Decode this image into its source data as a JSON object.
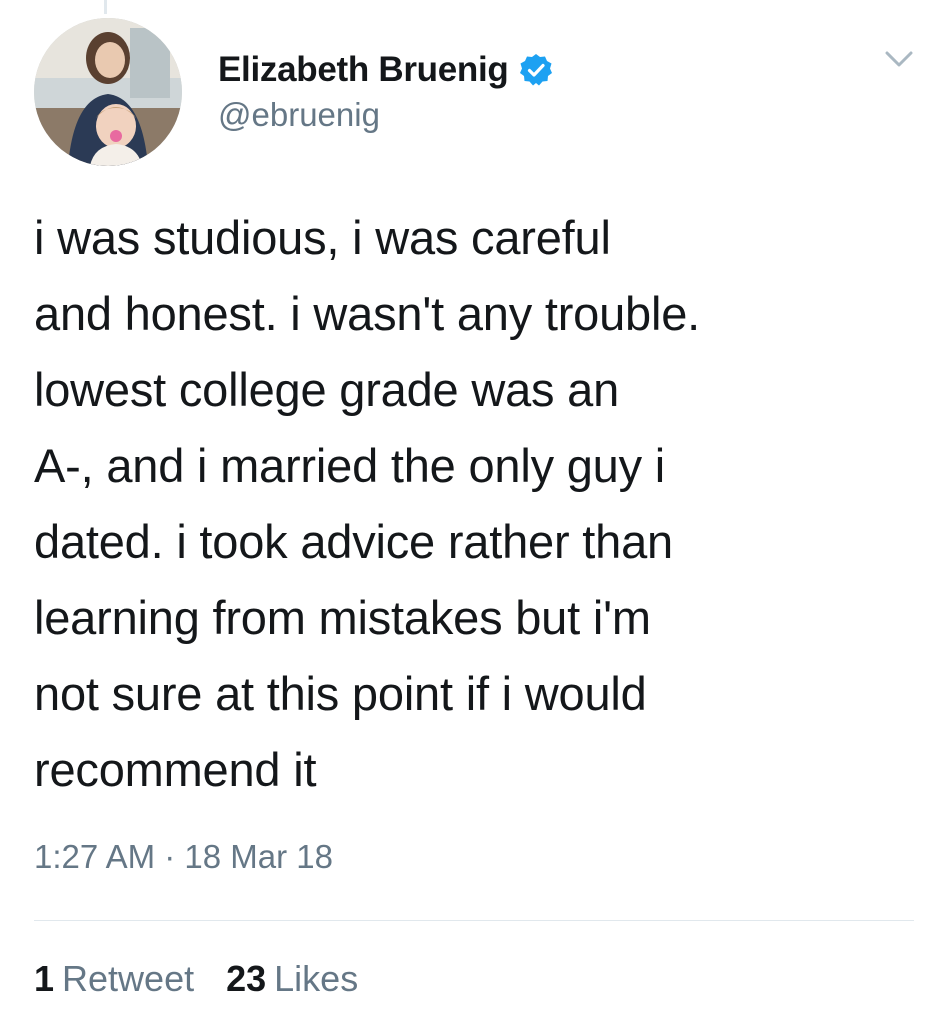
{
  "author": {
    "display_name": "Elizabeth Bruenig",
    "handle": "@ebruenig",
    "verified": true,
    "avatar_icon": "profile-photo"
  },
  "tweet": {
    "text": "i was studious, i was careful\nand honest. i wasn't any trouble.\nlowest college grade was an\nA-, and i married the only guy i\ndated. i took advice rather than\nlearning from mistakes but i'm\nnot sure at this point if i would\nrecommend it",
    "timestamp": "1:27 AM · 18 Mar 18"
  },
  "stats": {
    "retweets_count": "1",
    "retweets_label": "Retweet",
    "likes_count": "23",
    "likes_label": "Likes"
  },
  "colors": {
    "text": "#14171a",
    "secondary": "#657786",
    "verified_blue": "#1da1f2",
    "divider": "#e1e8ed"
  },
  "icons": {
    "verified": "verified-badge-icon",
    "menu": "chevron-down-icon"
  }
}
